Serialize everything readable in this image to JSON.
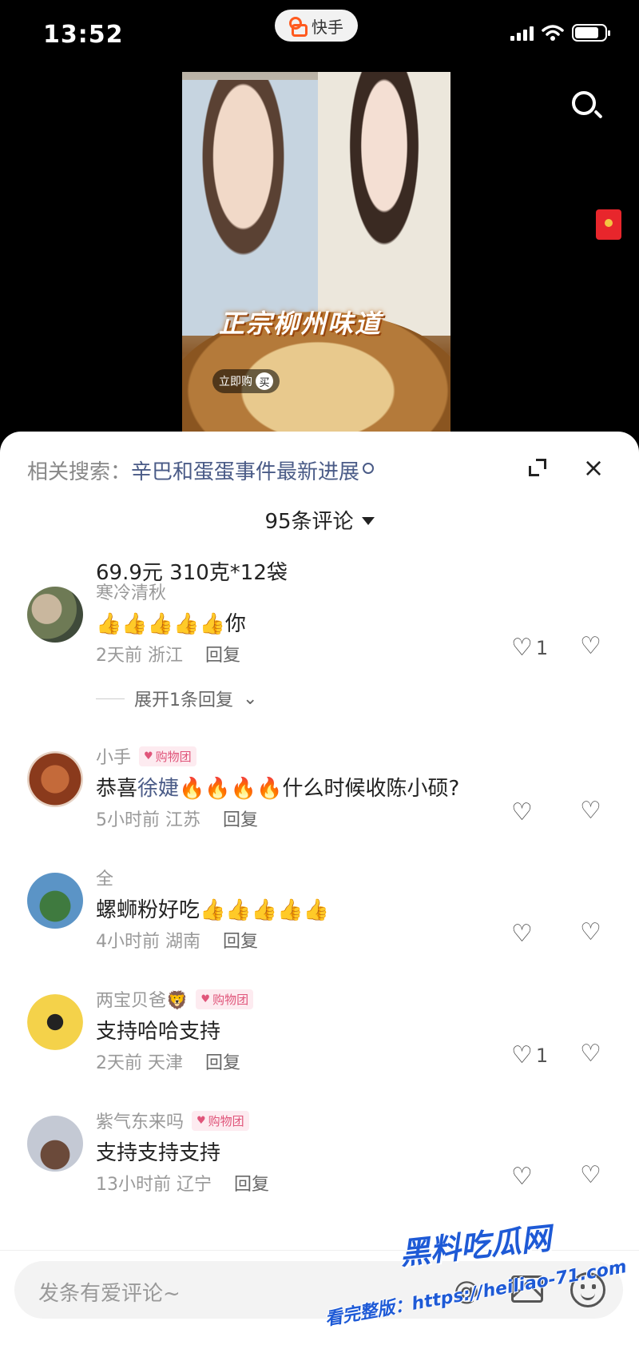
{
  "status_bar": {
    "time": "13:52",
    "app_name": "快手"
  },
  "video": {
    "caption": "正宗柳州味道",
    "buy_label": "立即购",
    "buy_badge": "买"
  },
  "sheet": {
    "related_prefix": "相关搜索：",
    "related_term": "辛巴和蛋蛋事件最新进展",
    "comment_count": "95条评论",
    "close_glyph": "×",
    "partial_text": "69.9元 310克*12袋"
  },
  "comments": [
    {
      "user": "寒冷清秋",
      "tag": "",
      "text_before": "👍👍👍👍👍你",
      "mention": "",
      "text_after": "",
      "time": "2天前",
      "region": "浙江",
      "reply": "回复",
      "likes": "1",
      "expand": "展开1条回复"
    },
    {
      "user": "小手",
      "tag": "购物团",
      "text_before": "恭喜",
      "mention": "徐婕",
      "text_after": "🔥🔥🔥🔥什么时候收陈小硕?",
      "time": "5小时前",
      "region": "江苏",
      "reply": "回复",
      "likes": ""
    },
    {
      "user": "全",
      "tag": "",
      "text_before": "螺蛳粉好吃👍👍👍👍👍",
      "mention": "",
      "text_after": "",
      "time": "4小时前",
      "region": "湖南",
      "reply": "回复",
      "likes": ""
    },
    {
      "user": "两宝贝爸🦁",
      "tag": "购物团",
      "text_before": "支持哈哈支持",
      "mention": "",
      "text_after": "",
      "time": "2天前",
      "region": "天津",
      "reply": "回复",
      "likes": "1"
    },
    {
      "user": "紫气东来吗",
      "tag": "购物团",
      "text_before": "支持支持支持",
      "mention": "",
      "text_after": "",
      "time": "13小时前",
      "region": "辽宁",
      "reply": "回复",
      "likes": ""
    }
  ],
  "input": {
    "placeholder": "发条有爱评论~"
  },
  "watermark": {
    "title": "黑料吃瓜网",
    "url": "看完整版：https://heiliao-71.com"
  },
  "colors": {
    "link": "#4a5b87",
    "tag": "#e0557a",
    "watermark": "#1e5ad6"
  }
}
